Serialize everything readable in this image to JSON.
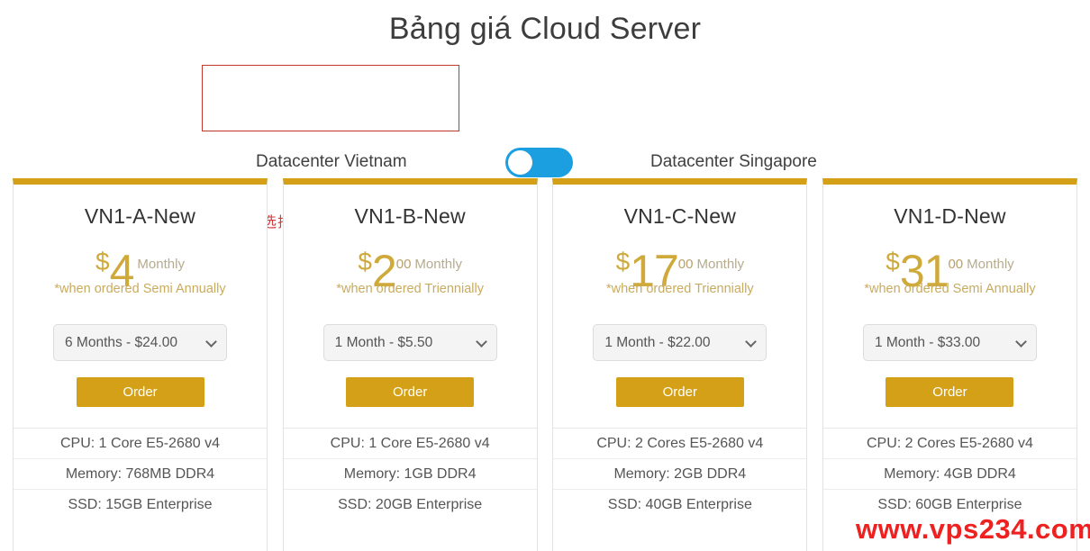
{
  "page": {
    "title": "Bảng giá Cloud Server"
  },
  "datacenter_switch": {
    "left_label": "Datacenter Vietnam",
    "right_label": "Datacenter Singapore",
    "annotation_text": "选择越南机房",
    "annotation_color": "#c0392b",
    "toggle_state": "left",
    "toggle_color": "#1b9fe0",
    "knob_color": "#ffffff"
  },
  "theme": {
    "accent_gold": "#d4a017",
    "price_gold": "#cfa93a",
    "watermark_red": "#ef2020"
  },
  "watermark": {
    "text": "www.vps234.com"
  },
  "plans": [
    {
      "name": "VN1-A-New",
      "currency": "$",
      "amount": "4",
      "cents": "",
      "per": "Monthly",
      "note": "*when ordered Semi Annually",
      "cycle_selected": "6 Months - $24.00",
      "order_label": "Order",
      "specs": [
        "CPU: 1 Core E5-2680 v4",
        "Memory: 768MB DDR4",
        "SSD: 15GB Enterprise"
      ]
    },
    {
      "name": "VN1-B-New",
      "currency": "$",
      "amount": "2",
      "cents": "00",
      "per": "Monthly",
      "note": "*when ordered Triennially",
      "cycle_selected": "1 Month - $5.50",
      "order_label": "Order",
      "specs": [
        "CPU: 1 Core E5-2680 v4",
        "Memory: 1GB DDR4",
        "SSD: 20GB Enterprise"
      ]
    },
    {
      "name": "VN1-C-New",
      "currency": "$",
      "amount": "17",
      "cents": "00",
      "per": "Monthly",
      "note": "*when ordered Triennially",
      "cycle_selected": "1 Month - $22.00",
      "order_label": "Order",
      "specs": [
        "CPU: 2 Cores E5-2680 v4",
        "Memory: 2GB DDR4",
        "SSD: 40GB Enterprise"
      ]
    },
    {
      "name": "VN1-D-New",
      "currency": "$",
      "amount": "31",
      "cents": "00",
      "per": "Monthly",
      "note": "*when ordered Semi Annually",
      "cycle_selected": "1 Month - $33.00",
      "order_label": "Order",
      "specs": [
        "CPU: 2 Cores E5-2680 v4",
        "Memory: 4GB DDR4",
        "SSD: 60GB Enterprise"
      ]
    }
  ]
}
